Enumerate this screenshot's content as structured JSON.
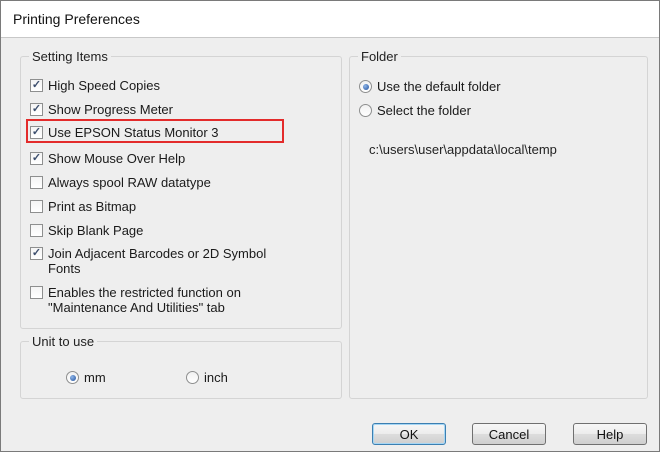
{
  "window": {
    "title": "Printing Preferences"
  },
  "setting_items": {
    "legend": "Setting Items",
    "items": [
      {
        "label": "High Speed Copies",
        "checked": true
      },
      {
        "label": "Show Progress Meter",
        "checked": true
      },
      {
        "label": "Use EPSON Status Monitor 3",
        "checked": true
      },
      {
        "label": "Show Mouse Over Help",
        "checked": true
      },
      {
        "label": "Always spool RAW datatype",
        "checked": false
      },
      {
        "label": "Print as Bitmap",
        "checked": false
      },
      {
        "label": "Skip Blank Page",
        "checked": false
      },
      {
        "label": "Join Adjacent Barcodes or 2D Symbol Fonts",
        "checked": true
      },
      {
        "label": "Enables the restricted function on \"Maintenance And Utilities\" tab",
        "checked": false
      }
    ]
  },
  "unit": {
    "legend": "Unit to use",
    "options": [
      {
        "label": "mm",
        "selected": true
      },
      {
        "label": "inch",
        "selected": false
      }
    ]
  },
  "folder": {
    "legend": "Folder",
    "options": [
      {
        "label": "Use the default folder",
        "selected": true
      },
      {
        "label": "Select the folder",
        "selected": false
      }
    ],
    "path": "c:\\users\\user\\appdata\\local\\temp"
  },
  "buttons": {
    "ok": "OK",
    "cancel": "Cancel",
    "help": "Help"
  },
  "colors": {
    "highlight": "#e32b2b",
    "dialog_bg": "#eeeeee"
  }
}
